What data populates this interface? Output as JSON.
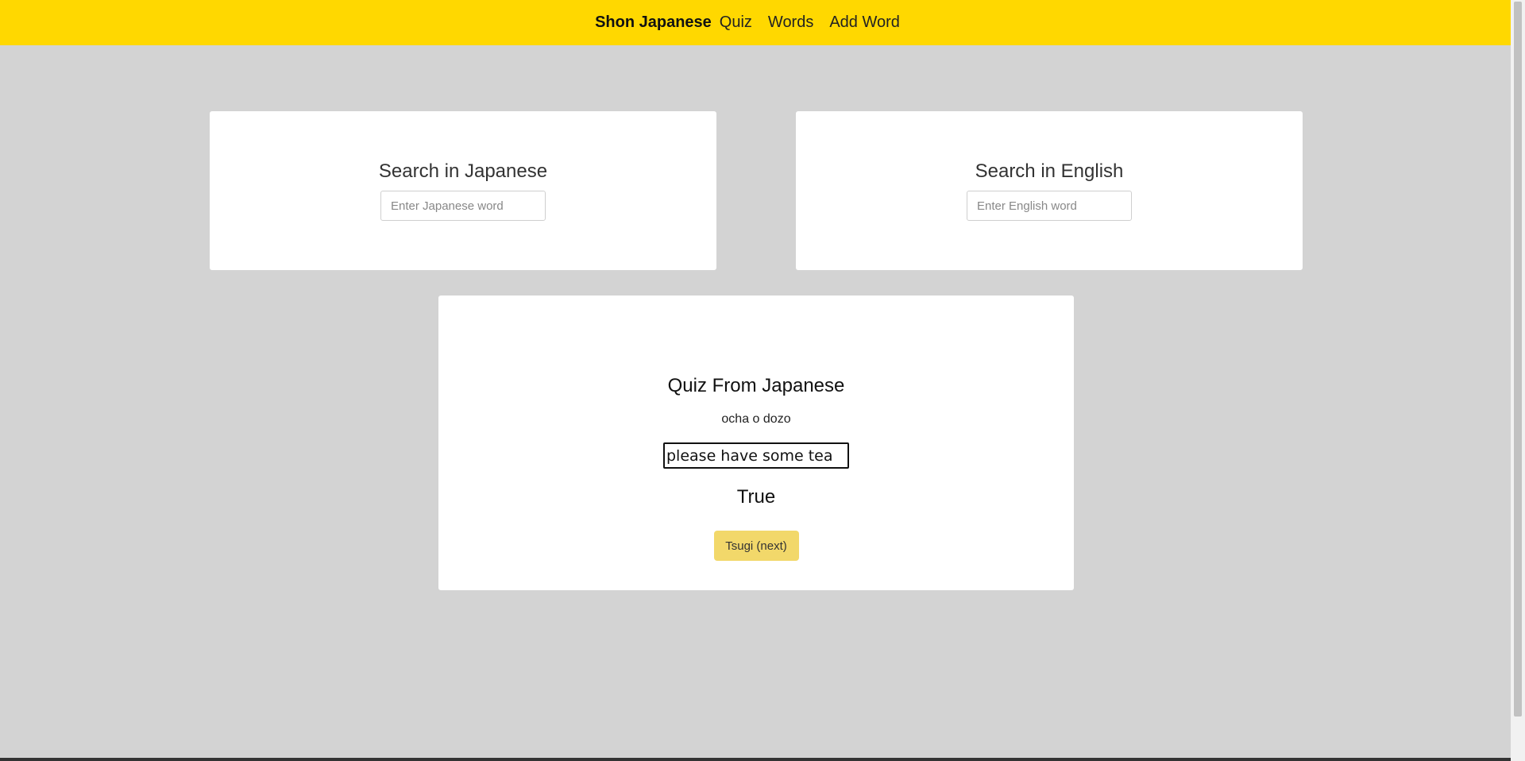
{
  "nav": {
    "brand": "Shon Japanese",
    "links": [
      "Quiz",
      "Words",
      "Add Word"
    ]
  },
  "search_japanese": {
    "title": "Search in Japanese",
    "placeholder": "Enter Japanese word"
  },
  "search_english": {
    "title": "Search in English",
    "placeholder": "Enter English word"
  },
  "quiz": {
    "title": "Quiz From Japanese",
    "prompt": "ocha o dozo",
    "answer_value": "please have some tea",
    "result": "True",
    "next_label": "Tsugi (next)"
  },
  "colors": {
    "nav_background": "#ffd800",
    "page_background": "#d3d3d3",
    "button_background": "#f2d86a"
  }
}
